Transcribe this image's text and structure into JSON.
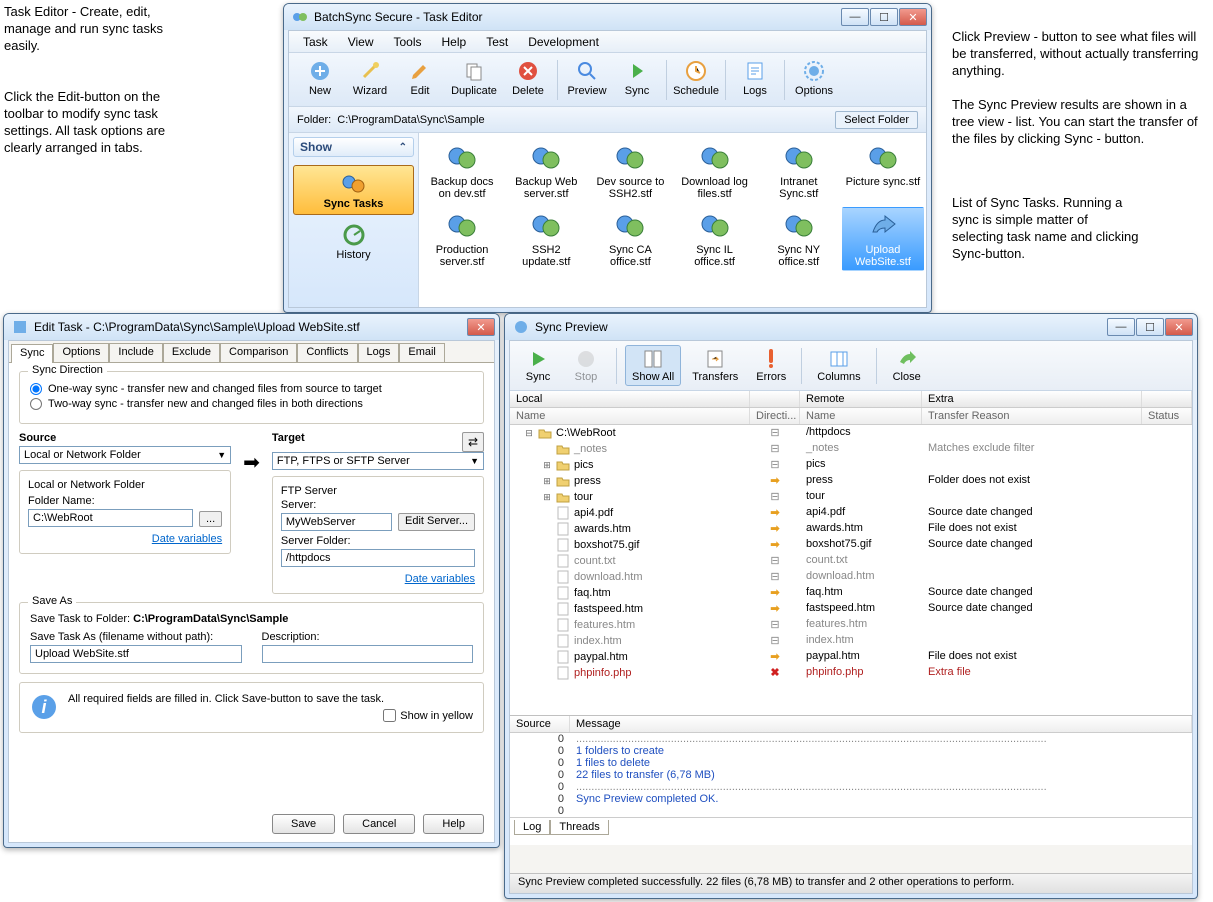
{
  "annotations": {
    "a1": "Task Editor - Create, edit, manage and run sync tasks easily.",
    "a2": "Click the Edit-button on the toolbar to modify sync task settings. All task options are clearly arranged in tabs.",
    "a3": "Click Preview - button to see what files will be transferred, without actually transferring anything.",
    "a4": "The Sync Preview results are shown in a tree view - list. You can start the transfer of the files by clicking Sync - button.",
    "a5": "List of Sync Tasks. Running a sync is simple matter of selecting task name and clicking Sync-button."
  },
  "taskEditor": {
    "title": "BatchSync Secure - Task Editor",
    "menu": [
      "Task",
      "View",
      "Tools",
      "Help",
      "Test",
      "Development"
    ],
    "toolbar": [
      "New",
      "Wizard",
      "Edit",
      "Duplicate",
      "Delete",
      "Preview",
      "Sync",
      "Schedule",
      "Logs",
      "Options"
    ],
    "folderLabel": "Folder:",
    "folderPath": "C:\\ProgramData\\Sync\\Sample",
    "selectFolder": "Select Folder",
    "side": {
      "show": "Show",
      "syncTasks": "Sync Tasks",
      "history": "History"
    },
    "tasks": [
      "Backup docs on dev.stf",
      "Backup Web server.stf",
      "Dev source to SSH2.stf",
      "Download log files.stf",
      "Intranet Sync.stf",
      "Picture sync.stf",
      "Production server.stf",
      "SSH2 update.stf",
      "Sync CA office.stf",
      "Sync IL office.stf",
      "Sync NY office.stf",
      "Upload WebSite.stf"
    ]
  },
  "editTask": {
    "title": "Edit Task - C:\\ProgramData\\Sync\\Sample\\Upload WebSite.stf",
    "tabs": [
      "Sync",
      "Options",
      "Include",
      "Exclude",
      "Comparison",
      "Conflicts",
      "Logs",
      "Email"
    ],
    "syncDir": {
      "label": "Sync Direction",
      "opt1": "One-way sync - transfer new and changed files from source to target",
      "opt2": "Two-way sync - transfer new and changed files in both directions"
    },
    "source": {
      "label": "Source",
      "combo": "Local or Network Folder",
      "sub": "Local or Network Folder",
      "folderNameLabel": "Folder Name:",
      "folderName": "C:\\WebRoot",
      "dateVars": "Date variables"
    },
    "target": {
      "label": "Target",
      "combo": "FTP, FTPS or SFTP Server",
      "sub": "FTP Server",
      "serverLabel": "Server:",
      "server": "MyWebServer",
      "editServer": "Edit Server...",
      "serverFolderLabel": "Server Folder:",
      "serverFolder": "/httpdocs",
      "dateVars": "Date variables"
    },
    "saveAs": {
      "label": "Save As",
      "line1a": "Save Task to Folder:",
      "line1b": "C:\\ProgramData\\Sync\\Sample",
      "fnLabel": "Save Task As (filename without path):",
      "descLabel": "Description:",
      "fn": "Upload WebSite.stf"
    },
    "info": "All required fields are filled in. Click Save-button to save the task.",
    "showYellow": "Show in yellow",
    "buttons": {
      "save": "Save",
      "cancel": "Cancel",
      "help": "Help"
    }
  },
  "preview": {
    "title": "Sync Preview",
    "toolbar": [
      "Sync",
      "Stop",
      "Show All",
      "Transfers",
      "Errors",
      "Columns",
      "Close"
    ],
    "groups": {
      "local": "Local",
      "remote": "Remote",
      "extra": "Extra"
    },
    "cols": {
      "name": "Name",
      "dir": "Directi...",
      "rname": "Name",
      "reason": "Transfer Reason",
      "status": "Status"
    },
    "rows": [
      {
        "ind": 0,
        "exp": "-",
        "name": "C:\\WebRoot",
        "d": "=",
        "r": "/httpdocs",
        "reason": "",
        "cls": ""
      },
      {
        "ind": 1,
        "exp": "",
        "name": "_notes",
        "d": "=",
        "r": "_notes",
        "reason": "Matches exclude filter",
        "cls": "muted"
      },
      {
        "ind": 1,
        "exp": "+",
        "name": "pics",
        "d": "=",
        "r": "pics",
        "reason": "",
        "cls": ""
      },
      {
        "ind": 1,
        "exp": "+",
        "name": "press",
        "d": ">",
        "r": "press",
        "reason": "Folder does not exist",
        "cls": ""
      },
      {
        "ind": 1,
        "exp": "+",
        "name": "tour",
        "d": "=",
        "r": "tour",
        "reason": "",
        "cls": ""
      },
      {
        "ind": 1,
        "exp": "",
        "name": "api4.pdf",
        "d": ">",
        "r": "api4.pdf",
        "reason": "Source date changed",
        "cls": ""
      },
      {
        "ind": 1,
        "exp": "",
        "name": "awards.htm",
        "d": ">",
        "r": "awards.htm",
        "reason": "File does not exist",
        "cls": ""
      },
      {
        "ind": 1,
        "exp": "",
        "name": "boxshot75.gif",
        "d": ">",
        "r": "boxshot75.gif",
        "reason": "Source date changed",
        "cls": ""
      },
      {
        "ind": 1,
        "exp": "",
        "name": "count.txt",
        "d": "=",
        "r": "count.txt",
        "reason": "",
        "cls": "muted"
      },
      {
        "ind": 1,
        "exp": "",
        "name": "download.htm",
        "d": "=",
        "r": "download.htm",
        "reason": "",
        "cls": "muted"
      },
      {
        "ind": 1,
        "exp": "",
        "name": "faq.htm",
        "d": ">",
        "r": "faq.htm",
        "reason": "Source date changed",
        "cls": ""
      },
      {
        "ind": 1,
        "exp": "",
        "name": "fastspeed.htm",
        "d": ">",
        "r": "fastspeed.htm",
        "reason": "Source date changed",
        "cls": ""
      },
      {
        "ind": 1,
        "exp": "",
        "name": "features.htm",
        "d": "=",
        "r": "features.htm",
        "reason": "",
        "cls": "muted"
      },
      {
        "ind": 1,
        "exp": "",
        "name": "index.htm",
        "d": "=",
        "r": "index.htm",
        "reason": "",
        "cls": "muted"
      },
      {
        "ind": 1,
        "exp": "",
        "name": "paypal.htm",
        "d": ">",
        "r": "paypal.htm",
        "reason": "File does not exist",
        "cls": ""
      },
      {
        "ind": 1,
        "exp": "",
        "name": "phpinfo.php",
        "d": "x",
        "r": "phpinfo.php",
        "reason": "Extra file",
        "cls": "redtext"
      }
    ],
    "msgs": {
      "hdrSrc": "Source",
      "hdrMsg": "Message",
      "items": [
        {
          "n": "0",
          "t": "..........................................................................................................................................................",
          "c": "msg0"
        },
        {
          "n": "0",
          "t": "1 folders to create",
          "c": "msg1"
        },
        {
          "n": "0",
          "t": "1 files to delete",
          "c": "msg1"
        },
        {
          "n": "0",
          "t": "22 files to transfer (6,78 MB)",
          "c": "msg1"
        },
        {
          "n": "0",
          "t": "..........................................................................................................................................................",
          "c": "msg0"
        },
        {
          "n": "0",
          "t": "Sync Preview completed OK.",
          "c": "msg1"
        },
        {
          "n": "0",
          "t": "",
          "c": "msg0"
        }
      ],
      "tabs": [
        "Log",
        "Threads"
      ]
    },
    "status": "Sync Preview completed successfully. 22 files (6,78 MB) to transfer and 2 other operations to perform."
  }
}
